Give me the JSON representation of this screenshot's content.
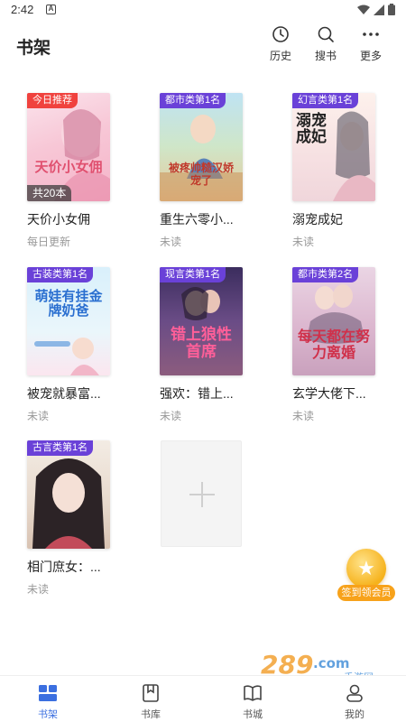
{
  "status_bar": {
    "time": "2:42",
    "badge": "A"
  },
  "header": {
    "title": "书架",
    "actions": [
      {
        "label": "历史",
        "icon": "clock-icon"
      },
      {
        "label": "搜书",
        "icon": "search-icon"
      },
      {
        "label": "更多",
        "icon": "more-dots-icon"
      }
    ]
  },
  "books": [
    {
      "tag": "今日推荐",
      "tag_color": "#f0423e",
      "cover_title": "天价小女佣",
      "count": "共20本",
      "name": "天价小女佣",
      "status": "每日更新"
    },
    {
      "tag": "都市类第1名",
      "tag_color": "#6a41d8",
      "cover_title": "被疼帅糙汉娇宠了",
      "name": "重生六零小...",
      "status": "未读"
    },
    {
      "tag": "幻言类第1名",
      "tag_color": "#6a41d8",
      "cover_title": "溺宠成妃",
      "name": "溺宠成妃",
      "status": "未读"
    },
    {
      "tag": "古装类第1名",
      "tag_color": "#6a41d8",
      "cover_title": "萌娃有挂金牌奶爸",
      "name": "被宠就暴富...",
      "status": "未读"
    },
    {
      "tag": "现言类第1名",
      "tag_color": "#6a41d8",
      "cover_title": "错上狼性首席",
      "name": "强欢：错上...",
      "status": "未读"
    },
    {
      "tag": "都市类第2名",
      "tag_color": "#6a41d8",
      "cover_title": "每天都在努力离婚",
      "name": "玄学大佬下...",
      "status": "未读"
    },
    {
      "tag": "古言类第1名",
      "tag_color": "#6a41d8",
      "cover_title": "",
      "name": "相门庶女：...",
      "status": "未读"
    }
  ],
  "sign_in": {
    "label": "签到领会员"
  },
  "watermark": {
    "text": "289.com",
    "sub": "手游网"
  },
  "bottom_nav": [
    {
      "label": "书架",
      "icon": "bookshelf-icon",
      "active": true
    },
    {
      "label": "书库",
      "icon": "library-icon",
      "active": false
    },
    {
      "label": "书城",
      "icon": "bookstore-icon",
      "active": false
    },
    {
      "label": "我的",
      "icon": "profile-icon",
      "active": false
    }
  ],
  "colors": {
    "accent": "#3b6fe0",
    "tag_red": "#f0423e",
    "tag_purple": "#6a41d8",
    "sign_in": "#f7a21b"
  }
}
